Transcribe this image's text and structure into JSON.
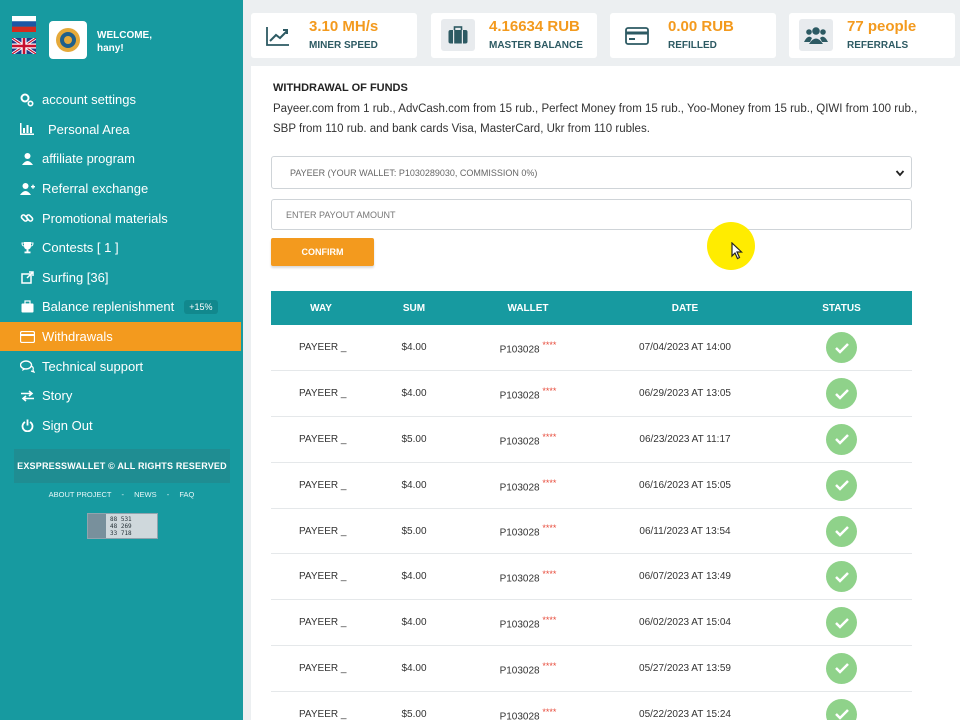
{
  "user": {
    "welcome": "WELCOME,",
    "name": "hany!"
  },
  "stats": [
    {
      "icon": "chart-line-icon",
      "value": "3.10 MH/s",
      "label": "MINER SPEED"
    },
    {
      "icon": "briefcase-icon",
      "value": "4.16634 RUB",
      "label": "MASTER BALANCE"
    },
    {
      "icon": "credit-card-icon",
      "value": "0.00 RUB",
      "label": "REFILLED"
    },
    {
      "icon": "users-icon",
      "value": "77 people",
      "label": "REFERRALS"
    }
  ],
  "sidebar": {
    "items": [
      {
        "icon": "gears-icon",
        "label": "account settings"
      },
      {
        "icon": "bar-chart-icon",
        "label": "Personal Area"
      },
      {
        "icon": "users-icon",
        "label": "affiliate program"
      },
      {
        "icon": "user-plus-icon",
        "label": "Referral exchange"
      },
      {
        "icon": "link-icon",
        "label": "Promotional materials"
      },
      {
        "icon": "trophy-icon",
        "label": "Contests [ 1 ]"
      },
      {
        "icon": "external-link-icon",
        "label": "Surfing [36]"
      },
      {
        "icon": "briefcase-icon",
        "label": "Balance replenishment",
        "badge": "+15%"
      },
      {
        "icon": "credit-card-icon",
        "label": "Withdrawals",
        "active": true
      },
      {
        "icon": "comments-icon",
        "label": "Technical support"
      },
      {
        "icon": "exchange-icon",
        "label": "Story"
      },
      {
        "icon": "power-icon",
        "label": "Sign Out"
      }
    ],
    "copyright": "EXSPRESSWALLET © ALL RIGHTS RESERVED",
    "footer_links": [
      "ABOUT PROJECT",
      "-",
      "NEWS",
      "-",
      "FAQ"
    ],
    "counter_lines": [
      "88 531",
      "48 269",
      "33 718"
    ]
  },
  "withdrawal": {
    "title": "WITHDRAWAL OF FUNDS",
    "description": "Payeer.com from 1 rub., AdvCash.com from 15 rub., Perfect Money from 15 rub., Yoo-Money from 15 rub., QIWI from 100 rub., SBP from 110 rub. and bank cards Visa, MasterCard, Ukr from 110 rubles.",
    "select_value": "PAYEER (YOUR WALLET: P1030289030, COMMISSION 0%)",
    "amount_placeholder": "ENTER PAYOUT AMOUNT",
    "confirm_label": "CONFIRM"
  },
  "table": {
    "headers": [
      "WAY",
      "SUM",
      "WALLET",
      "DATE",
      "STATUS"
    ],
    "rows": [
      {
        "way": "PAYEER _",
        "sum": "$4.00",
        "wallet": "P103028",
        "stars": "****",
        "date": "07/04/2023 AT 14:00"
      },
      {
        "way": "PAYEER _",
        "sum": "$4.00",
        "wallet": "P103028",
        "stars": "****",
        "date": "06/29/2023 AT 13:05"
      },
      {
        "way": "PAYEER _",
        "sum": "$5.00",
        "wallet": "P103028",
        "stars": "****",
        "date": "06/23/2023 AT 11:17"
      },
      {
        "way": "PAYEER _",
        "sum": "$4.00",
        "wallet": "P103028",
        "stars": "****",
        "date": "06/16/2023 AT 15:05"
      },
      {
        "way": "PAYEER _",
        "sum": "$5.00",
        "wallet": "P103028",
        "stars": "****",
        "date": "06/11/2023 AT 13:54"
      },
      {
        "way": "PAYEER _",
        "sum": "$4.00",
        "wallet": "P103028",
        "stars": "****",
        "date": "06/07/2023 AT 13:49"
      },
      {
        "way": "PAYEER _",
        "sum": "$4.00",
        "wallet": "P103028",
        "stars": "****",
        "date": "06/02/2023 AT 15:04"
      },
      {
        "way": "PAYEER _",
        "sum": "$4.00",
        "wallet": "P103028",
        "stars": "****",
        "date": "05/27/2023 AT 13:59"
      },
      {
        "way": "PAYEER _",
        "sum": "$5.00",
        "wallet": "P103028",
        "stars": "****",
        "date": "05/22/2023 AT 15:24"
      }
    ]
  },
  "colors": {
    "teal": "#179aa0",
    "orange": "#f39a1e",
    "success": "#8fd28a"
  }
}
